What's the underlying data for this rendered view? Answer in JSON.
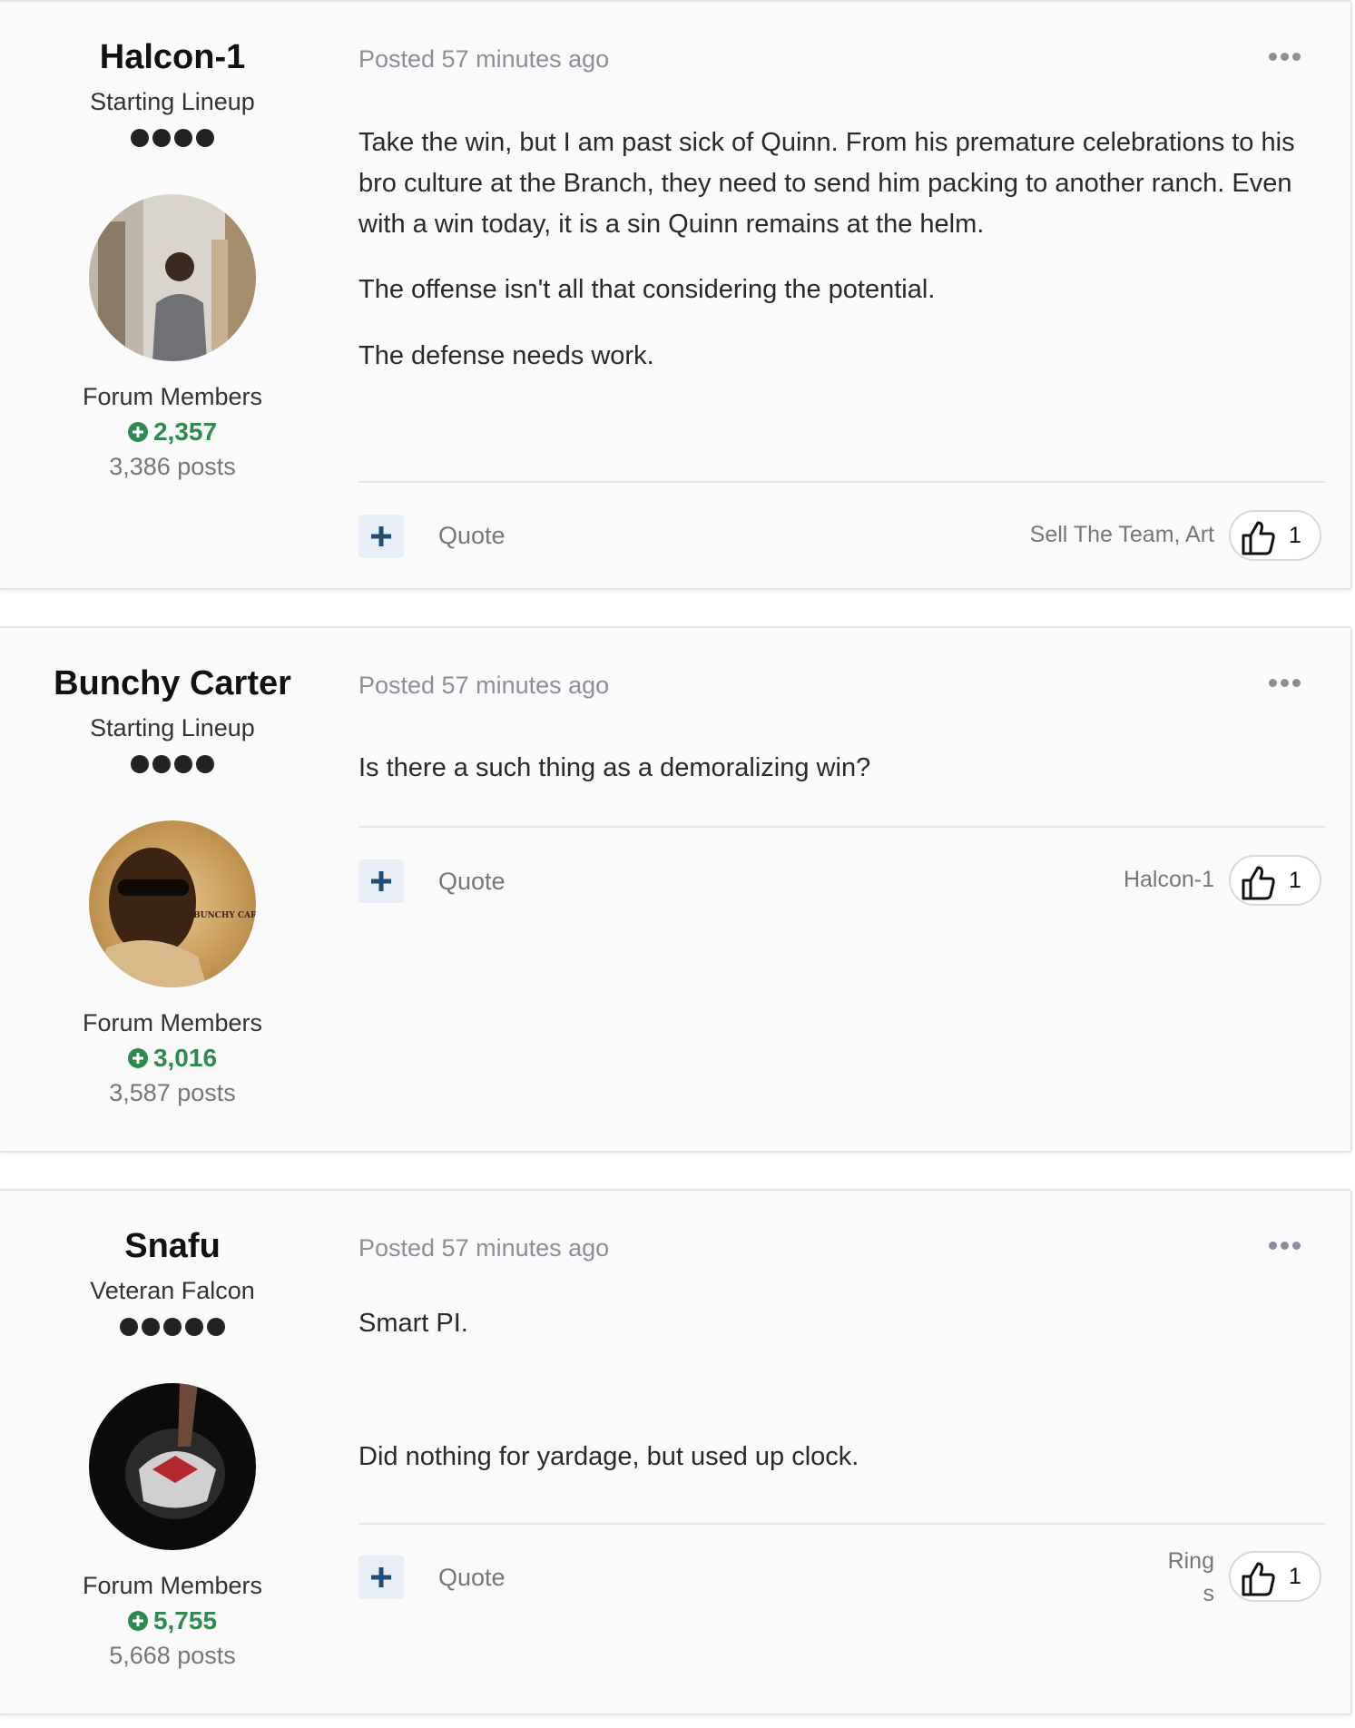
{
  "posts": [
    {
      "author": "Halcon-1",
      "rank": "Starting Lineup",
      "pips": 4,
      "group": "Forum Members",
      "reputation": "2,357",
      "post_count": "3,386 posts",
      "posted": "Posted 57 minutes ago",
      "paragraphs": [
        "Take the win, but I am past sick of Quinn. From his premature celebrations to his bro culture at the Branch, they need to send him packing to another ranch. Even with a win today, it is a sin Quinn remains at the helm.",
        "The offense isn't all that considering the potential.",
        "The defense needs work."
      ],
      "quote_label": "Quote",
      "likers": "Sell The Team, Art",
      "like_count": "1"
    },
    {
      "author": "Bunchy Carter",
      "rank": "Starting Lineup",
      "pips": 4,
      "group": "Forum Members",
      "reputation": "3,016",
      "post_count": "3,587 posts",
      "posted": "Posted 57 minutes ago",
      "paragraphs": [
        "Is there a such thing as a demoralizing win?"
      ],
      "quote_label": "Quote",
      "likers": "Halcon-1",
      "like_count": "1",
      "avatar_text": "BUNCHY CART"
    },
    {
      "author": "Snafu",
      "rank": "Veteran Falcon",
      "pips": 5,
      "group": "Forum Members",
      "reputation": "5,755",
      "post_count": "5,668 posts",
      "posted": "Posted 57 minutes ago",
      "paragraphs": [
        "Smart PI.",
        "Did nothing for yardage, but used up clock."
      ],
      "quote_label": "Quote",
      "likers_line1": "Ring",
      "likers_line2": "s",
      "like_count": "1"
    }
  ],
  "colors": {
    "reputation_green": "#2e8a4f",
    "quote_button_bg": "#e8eef5",
    "plus_color": "#1f4e79",
    "meta_gray": "#8a8f99"
  },
  "icons": [
    "options-dots-icon",
    "reputation-plus-icon",
    "thumbs-up-icon",
    "plus-icon"
  ]
}
